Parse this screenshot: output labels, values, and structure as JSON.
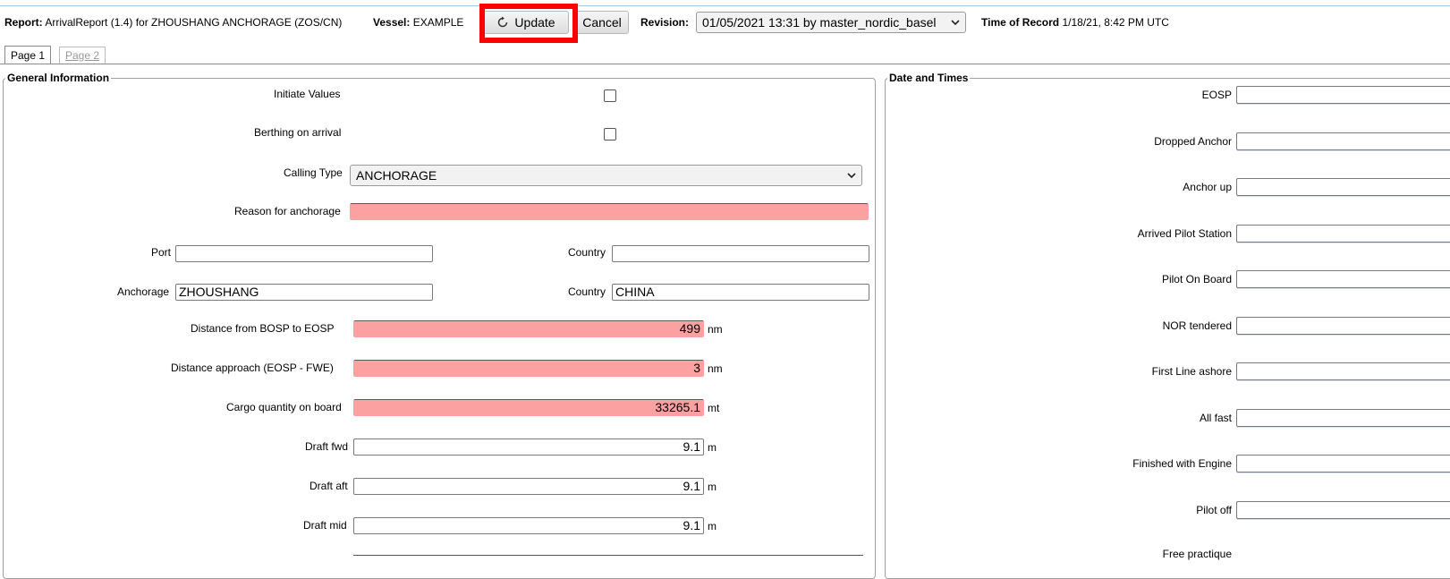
{
  "header": {
    "report_label": "Report:",
    "report_value": "ArrivalReport (1.4) for ZHOUSHANG ANCHORAGE (ZOS/CN)",
    "vessel_label": "Vessel:",
    "vessel_value": "EXAMPLE",
    "update_label": "Update",
    "cancel_label": "Cancel",
    "revision_label": "Revision:",
    "revision_value": "01/05/2021 13:31 by master_nordic_basel",
    "time_label": "Time of Record",
    "time_value": "1/18/21, 8:42 PM UTC"
  },
  "tabs": [
    {
      "label": "Page 1",
      "active": true
    },
    {
      "label": "Page 2",
      "active": false
    }
  ],
  "general": {
    "title": "General Information",
    "initiate_label": "Initiate Values",
    "berthing_label": "Berthing on arrival",
    "calling_type_label": "Calling Type",
    "calling_type_value": "ANCHORAGE",
    "reason_label": "Reason for anchorage",
    "reason_value": "",
    "port_label": "Port",
    "port_value": "",
    "port_country_label": "Country",
    "port_country_value": "",
    "anchorage_label": "Anchorage",
    "anchorage_value": "ZHOUSHANG",
    "anchorage_country_label": "Country",
    "anchorage_country_value": "CHINA",
    "dist_bosp_label": "Distance from BOSP to EOSP",
    "dist_bosp_value": "499",
    "dist_bosp_unit": "nm",
    "dist_approach_label": "Distance approach (EOSP - FWE)",
    "dist_approach_value": "3",
    "dist_approach_unit": "nm",
    "cargo_label": "Cargo quantity on board",
    "cargo_value": "33265.1",
    "cargo_unit": "mt",
    "draft_fwd_label": "Draft fwd",
    "draft_fwd_value": "9.1",
    "draft_fwd_unit": "m",
    "draft_aft_label": "Draft aft",
    "draft_aft_value": "9.1",
    "draft_aft_unit": "m",
    "draft_mid_label": "Draft mid",
    "draft_mid_value": "9.1",
    "draft_mid_unit": "m"
  },
  "dates": {
    "title": "Date and Times",
    "eosp_label": "EOSP",
    "dropped_anchor_label": "Dropped Anchor",
    "anchor_up_label": "Anchor up",
    "arrived_pilot_label": "Arrived Pilot Station",
    "pilot_on_board_label": "Pilot On Board",
    "nor_label": "NOR tendered",
    "first_line_label": "First Line ashore",
    "all_fast_label": "All fast",
    "fwe_label": "Finished with Engine",
    "pilot_off_label": "Pilot off",
    "free_practique_label": "Free practique"
  },
  "colors": {
    "required_field": "#fca1a1",
    "highlight": "#ff0000"
  },
  "icons": {
    "update": "refresh-icon",
    "dropdown": "chevron-down-icon"
  }
}
